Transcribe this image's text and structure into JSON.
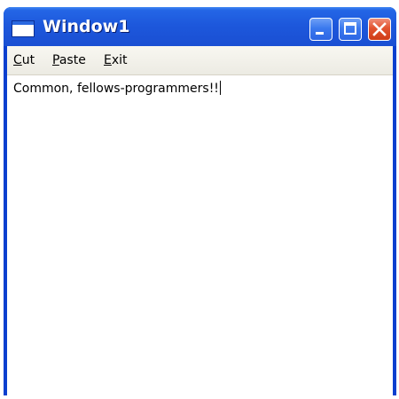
{
  "window": {
    "title": "Window1",
    "icon": "window-app-icon",
    "controls": {
      "minimize": "minimize-icon",
      "maximize": "maximize-icon",
      "close": "close-icon"
    },
    "colors": {
      "titlebar": "#1d58dc",
      "close_button": "#e2532f",
      "menubar": "#ecebe3"
    }
  },
  "menu": {
    "cut": {
      "mnemonic": "C",
      "rest": "ut"
    },
    "paste": {
      "mnemonic": "P",
      "rest": "aste"
    },
    "exit": {
      "mnemonic": "E",
      "rest": "xit"
    }
  },
  "editor": {
    "text": "Common, fellows-programmers!!"
  }
}
